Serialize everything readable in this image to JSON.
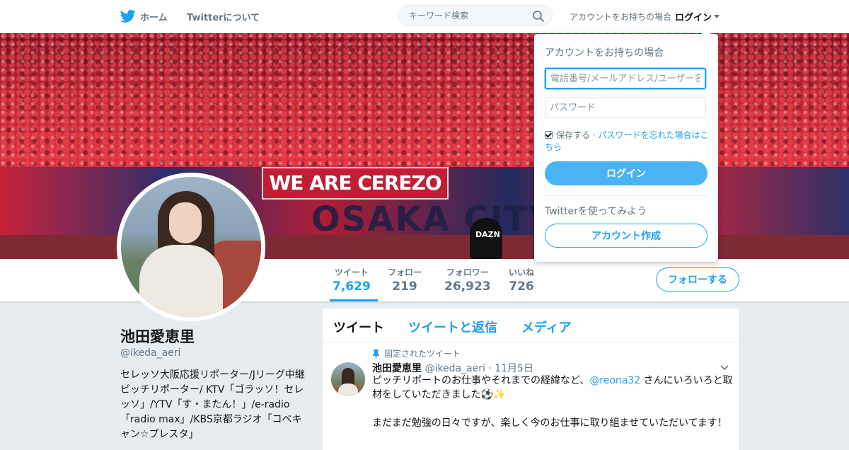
{
  "nav": {
    "home_label": "ホーム",
    "about_label": "Twitterについて",
    "search_placeholder": "キーワード検索",
    "login_prompt": "アカウントをお持ちの場合",
    "login_label": "ログイン"
  },
  "banner": {
    "text1": "WE ARE CEREZO",
    "text2": "OSAKA CITY",
    "dazn": "DAZN"
  },
  "stats": [
    {
      "label": "ツイート",
      "value": "7,629"
    },
    {
      "label": "フォロー",
      "value": "219"
    },
    {
      "label": "フォロワー",
      "value": "26,923"
    },
    {
      "label": "いいね",
      "value": "726"
    }
  ],
  "follow_button": "フォローする",
  "profile": {
    "name": "池田愛恵里",
    "handle": "@ikeda_aeri",
    "bio": "セレッソ大阪応援リポーター/Jリーグ中継 ピッチリポーター/ KTV「ゴラッソ！セレッソ」/YTV「す・またん！」/e-radio「radio max」/KBS京都ラジオ「コベキャン☆プレスタ」"
  },
  "timeline": {
    "tabs": [
      "ツイート",
      "ツイートと返信",
      "メディア"
    ],
    "pinned_label": "固定されたツイート",
    "tweet": {
      "name": "池田愛恵里",
      "handle": "@ikeda_aeri",
      "date": "11月5日",
      "text_before": "ピッチリポートのお仕事やそれまでの経緯など、",
      "mention": "@reona32",
      "text_after": " さんにいろいろと取材をしていただきました⚽✨\n\nまだまだ勉強の日々ですが、楽しく今のお仕事に取り組ませていただいてます！"
    }
  },
  "login_dropdown": {
    "title": "アカウントをお持ちの場合",
    "username_placeholder": "電話番号/メールアドレス/ユーザー名",
    "password_placeholder": "パスワード",
    "remember_label": "保存する",
    "separator": " · ",
    "forgot_label": "パスワードを忘れた場合はこちら",
    "login_button": "ログイン",
    "try_label": "Twitterを使ってみよう",
    "signup_button": "アカウント作成"
  },
  "colors": {
    "accent": "#1da1f2",
    "login_button": "#4ab3f4",
    "page_bg": "#e6ecf0"
  }
}
